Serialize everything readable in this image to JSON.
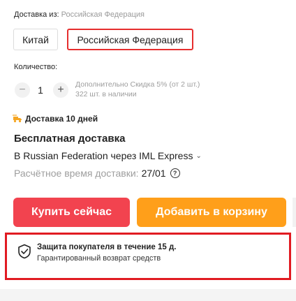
{
  "ship_from": {
    "label": "Доставка из:",
    "value": "Российская Федерация"
  },
  "ship_options": [
    "Китай",
    "Российская Федерация"
  ],
  "quantity": {
    "label": "Количество:",
    "minus": "−",
    "value": "1",
    "plus": "+",
    "discount_note": "Дополнительно Скидка 5% (от 2 шт.)",
    "stock": "322 шт. в наличии"
  },
  "delivery": {
    "days_label": "Доставка 10 дней",
    "free_label": "Бесплатная доставка",
    "route": "В Russian Federation через IML Express",
    "eta_label": "Расчётное время доставки:",
    "eta_date": "27/01",
    "help_icon": "question-circle-icon"
  },
  "actions": {
    "buy_now": "Купить сейчас",
    "add_to_cart": "Добавить в корзину"
  },
  "protection": {
    "title": "Защита покупателя в течение 15 д.",
    "subtitle": "Гарантированный возврат средств",
    "icon": "shield-check-icon"
  },
  "colors": {
    "accent_red": "#f2434f",
    "accent_orange": "#ff9f1a",
    "highlight_border": "#e11b22",
    "truck_icon": "#f5a623"
  }
}
